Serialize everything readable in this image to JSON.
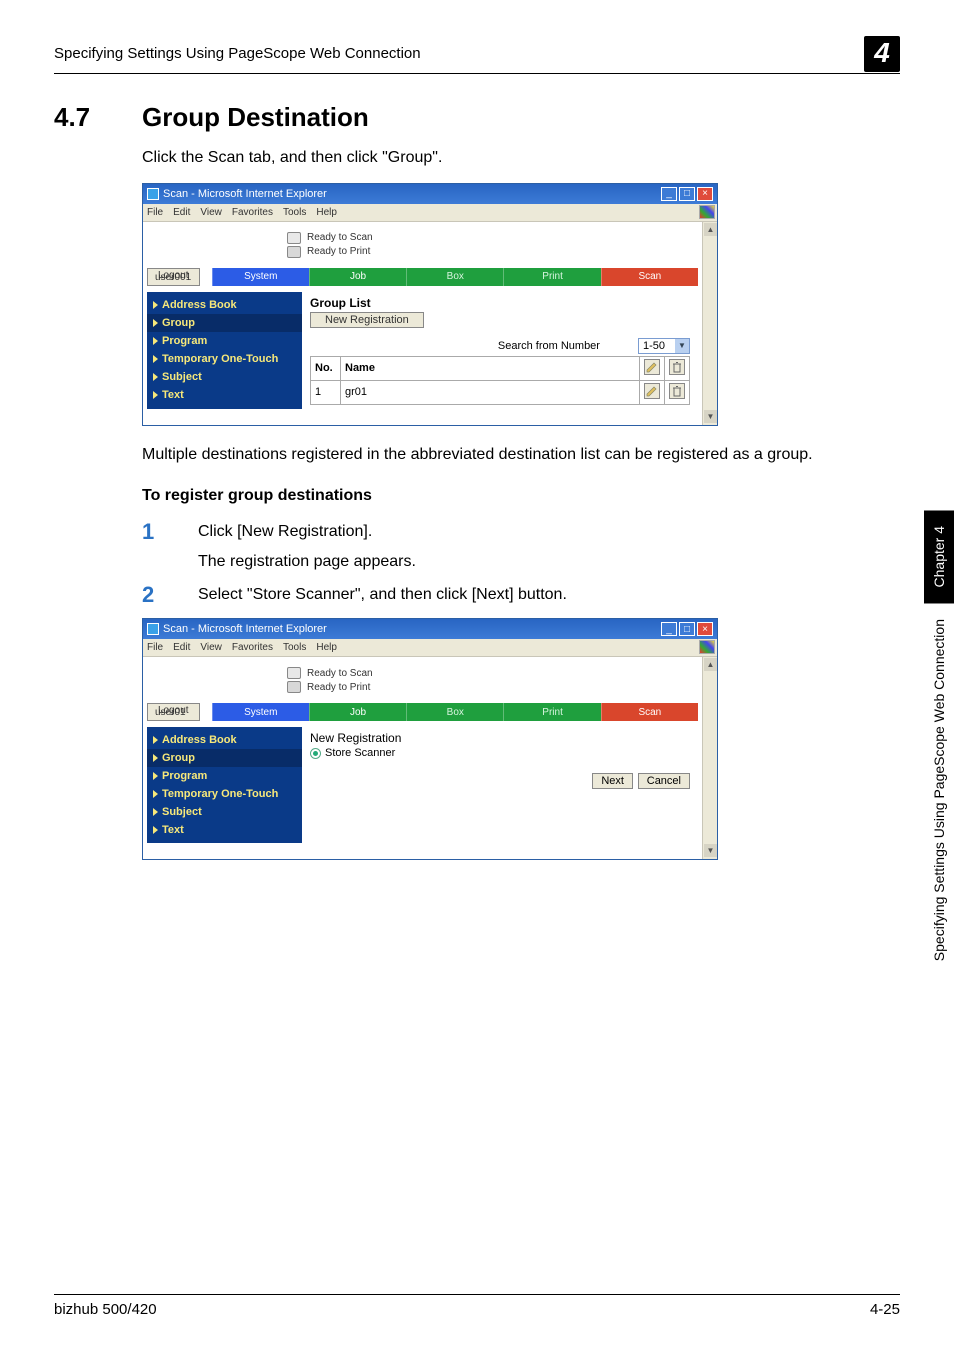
{
  "doc": {
    "breadcrumb": "Specifying Settings Using PageScope Web Connection",
    "chapter_num": "4",
    "section_num": "4.7",
    "section_title": "Group Destination",
    "intro": "Click the Scan tab, and then click \"Group\".",
    "mid_para": "Multiple destinations registered in the abbreviated destination list can be registered as a group.",
    "subhead": "To register group destinations",
    "steps": {
      "s1": {
        "num": "1",
        "a": "Click [New Registration].",
        "b": "The registration page appears."
      },
      "s2": {
        "num": "2",
        "a": "Select \"Store Scanner\", and then click [Next] button."
      }
    }
  },
  "sidetab": {
    "black": "Chapter 4",
    "gray": "Specifying Settings Using PageScope Web Connection"
  },
  "footer": {
    "left": "bizhub 500/420",
    "right": "4-25"
  },
  "ie": {
    "title": "Scan - Microsoft Internet Explorer",
    "menu": {
      "file": "File",
      "edit": "Edit",
      "view": "View",
      "fav": "Favorites",
      "tools": "Tools",
      "help": "Help"
    },
    "status": {
      "scan": "Ready to Scan",
      "print": "Ready to Print"
    },
    "logout": "Logout",
    "tabs": {
      "system": "System",
      "job": "Job",
      "box": "Box",
      "print": "Print",
      "scan": "Scan"
    },
    "nav": {
      "address_book": "Address Book",
      "group": "Group",
      "program": "Program",
      "temp": "Temporary One-Touch",
      "subject": "Subject",
      "text": "Text"
    }
  },
  "shot1": {
    "user": "user001",
    "panel_title": "Group List",
    "new_reg": "New Registration",
    "search_label": "Search from Number",
    "range_sel": "1-50",
    "table": {
      "col_no": "No.",
      "col_name": "Name",
      "rows": [
        {
          "no": "1",
          "name": "gr01"
        }
      ]
    }
  },
  "shot2": {
    "user": "user01",
    "panel_title": "New Registration",
    "radio_label": "Store Scanner",
    "next": "Next",
    "cancel": "Cancel"
  }
}
